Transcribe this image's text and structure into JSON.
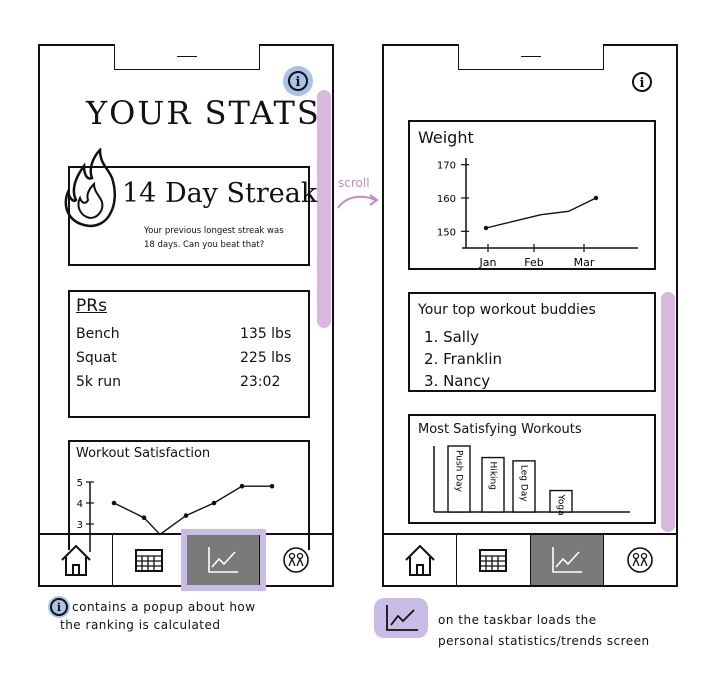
{
  "annotations": {
    "scroll_label": "scroll",
    "info_note": "contains a popup about how the ranking is calculated",
    "info_note_line1": "contains a popup about how",
    "info_note_line2": "the ranking is calculated",
    "taskbar_note_line1": "on the taskbar loads the",
    "taskbar_note_line2": "personal statistics/trends screen"
  },
  "screen1": {
    "title": "YOUR STATS",
    "info_icon": "i",
    "streak": {
      "headline": "14 Day Streak",
      "sub_line1": "Your previous longest streak was",
      "sub_line2": "18 days. Can you beat that?"
    },
    "prs": {
      "heading": "PRs",
      "rows": [
        {
          "label": "Bench",
          "value": "135 lbs"
        },
        {
          "label": "Squat",
          "value": "225 lbs"
        },
        {
          "label": "5k run",
          "value": "23:02"
        }
      ]
    },
    "satisfaction": {
      "heading": "Workout Satisfaction",
      "y_ticks": [
        "5",
        "4",
        "3"
      ]
    }
  },
  "screen2": {
    "info_icon": "i",
    "weight_card": {
      "heading": "Weight"
    },
    "buddies": {
      "heading": "Your top workout buddies",
      "items": [
        "1. Sally",
        "2. Franklin",
        "3. Nancy"
      ]
    },
    "workouts": {
      "heading": "Most Satisfying Workouts",
      "bars": [
        "Push Day",
        "Hiking",
        "Leg Day",
        "Yoga"
      ]
    }
  },
  "tabs": [
    "home-icon",
    "calendar-icon",
    "chart-icon",
    "buddies-icon"
  ],
  "colors": {
    "highlight": "#c9bce6",
    "scrollbar": "#d9b8dd",
    "info_badge": "#a9c3e8",
    "active_tab": "#7a7a7a",
    "scroll_arrow": "#c48bc8"
  },
  "chart_data": [
    {
      "type": "line",
      "title": "Weight",
      "categories": [
        "Jan",
        "Feb",
        "Mar"
      ],
      "yticks": [
        150,
        160,
        170
      ],
      "series": [
        {
          "values": [
            151,
            153,
            155,
            156,
            160
          ]
        }
      ]
    },
    {
      "type": "line",
      "title": "Workout Satisfaction",
      "yticks": [
        3,
        4,
        5
      ],
      "series": [
        {
          "values": [
            4,
            3.3,
            2.5,
            3.4,
            4,
            4.8,
            4.8
          ]
        }
      ]
    },
    {
      "type": "bar",
      "title": "Most Satisfying Workouts",
      "categories": [
        "Push Day",
        "Hiking",
        "Leg Day",
        "Yoga"
      ],
      "series": [
        {
          "values": [
            4,
            3.3,
            3.1,
            1.3
          ]
        }
      ]
    }
  ]
}
